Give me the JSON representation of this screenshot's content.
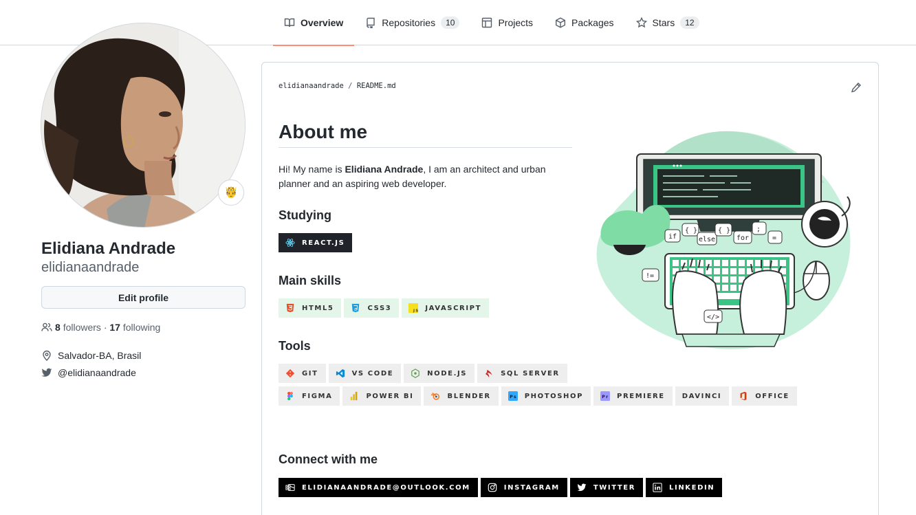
{
  "tabs": [
    {
      "label": "Overview",
      "icon": "book-icon",
      "active": true
    },
    {
      "label": "Repositories",
      "icon": "repo-icon",
      "count": "10"
    },
    {
      "label": "Projects",
      "icon": "table-icon"
    },
    {
      "label": "Packages",
      "icon": "package-icon"
    },
    {
      "label": "Stars",
      "icon": "star-icon",
      "count": "12"
    }
  ],
  "profile": {
    "name": "Elidiana Andrade",
    "login": "elidianaandrade",
    "status_emoji": "🤴",
    "edit_label": "Edit profile",
    "followers_count": "8",
    "followers_label": "followers",
    "separator": "·",
    "following_count": "17",
    "following_label": "following",
    "location": "Salvador-BA, Brasil",
    "twitter": "@elidianaandrade"
  },
  "readme": {
    "owner": "elidianaandrade",
    "sep": "/",
    "file": "README.md",
    "title": "About me",
    "intro_pre": "Hi! My name is ",
    "intro_name": "Elidiana Andrade",
    "intro_post": ", I am an architect and urban planner and an aspiring web developer.",
    "studying_heading": "Studying",
    "studying": [
      {
        "label": "REACT.JS",
        "icon": "react-icon",
        "color": "#61dafb"
      }
    ],
    "skills_heading": "Main skills",
    "skills": [
      {
        "label": "HTML5",
        "icon": "html5-icon",
        "color": "#e34f26"
      },
      {
        "label": "CSS3",
        "icon": "css3-icon",
        "color": "#1572b6"
      },
      {
        "label": "JAVASCRIPT",
        "icon": "javascript-icon",
        "color": "#f7df1e"
      }
    ],
    "tools_heading": "Tools",
    "tools_row1": [
      {
        "label": "GIT",
        "icon": "git-icon",
        "color": "#f05032"
      },
      {
        "label": "VS CODE",
        "icon": "vscode-icon",
        "color": "#007acc"
      },
      {
        "label": "NODE.JS",
        "icon": "nodejs-icon",
        "color": "#339933"
      },
      {
        "label": "SQL SERVER",
        "icon": "sqlserver-icon",
        "color": "#cc2927"
      }
    ],
    "tools_row2": [
      {
        "label": "FIGMA",
        "icon": "figma-icon",
        "color": "#f24e1e"
      },
      {
        "label": "POWER BI",
        "icon": "powerbi-icon",
        "color": "#f2c811"
      },
      {
        "label": "BLENDER",
        "icon": "blender-icon",
        "color": "#f5792a"
      },
      {
        "label": "PHOTOSHOP",
        "icon": "photoshop-icon",
        "color": "#31a8ff"
      },
      {
        "label": "PREMIERE",
        "icon": "premiere-icon",
        "color": "#9999ff"
      },
      {
        "label": "DAVINCI"
      },
      {
        "label": "OFFICE",
        "icon": "office-icon",
        "color": "#d83b01"
      }
    ],
    "connect_heading": "Connect with me",
    "connect": [
      {
        "label": "ELIDIANAANDRADE@OUTLOOK.COM",
        "icon": "outlook-icon"
      },
      {
        "label": "INSTAGRAM",
        "icon": "instagram-icon"
      },
      {
        "label": "TWITTER",
        "icon": "twitter-icon"
      },
      {
        "label": "LINKEDIN",
        "icon": "linkedin-icon"
      }
    ],
    "illustration_words": [
      "if",
      "{ }",
      "else",
      "{ }",
      "for",
      ";",
      "=",
      "!=",
      "</>"
    ]
  },
  "colors": {
    "accent_tab": "#fd8c73",
    "mint": "#c3f2da",
    "mint_dark": "#3ac486",
    "badge_light": "#e3f6e9",
    "badge_dark": "#20232a"
  }
}
